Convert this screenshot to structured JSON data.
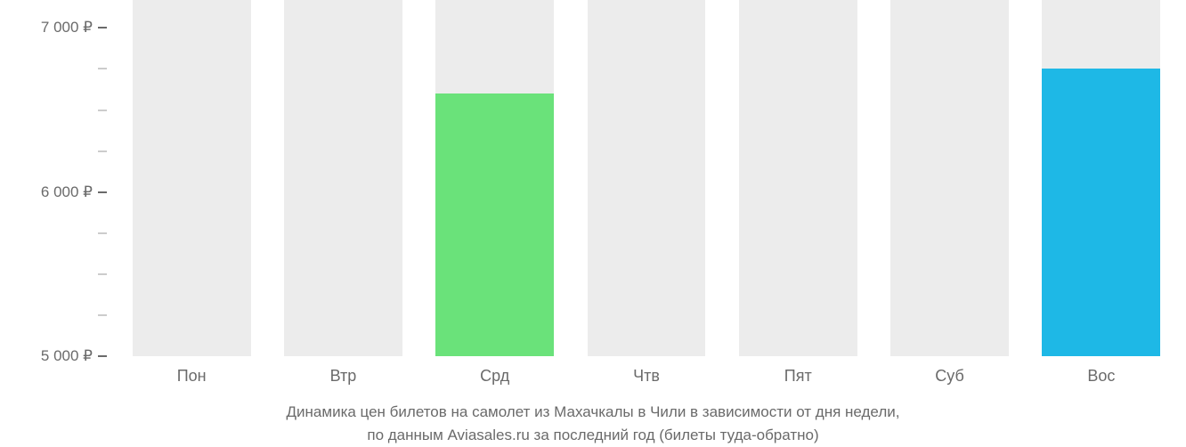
{
  "chart_data": {
    "type": "bar",
    "categories": [
      "Пон",
      "Втр",
      "Срд",
      "Чтв",
      "Пят",
      "Суб",
      "Вос"
    ],
    "values": [
      null,
      null,
      6600,
      null,
      null,
      null,
      6750
    ],
    "max_height_value": 7170,
    "y_ticks": [
      {
        "label": "5 000 ₽",
        "value": 5000
      },
      {
        "label": "6 000 ₽",
        "value": 6000
      },
      {
        "label": "7 000 ₽",
        "value": 7000
      }
    ],
    "y_minor_ticks": [
      5250,
      5500,
      5750,
      6250,
      6500,
      6750
    ],
    "ylim": [
      5000,
      7170
    ],
    "xlabel": "",
    "ylabel": "",
    "colors": {
      "placeholder": "#ececec",
      "lowest": "#6ae27a",
      "highlight": "#1eb8e6"
    },
    "bar_colors": [
      "placeholder",
      "placeholder",
      "lowest",
      "placeholder",
      "placeholder",
      "placeholder",
      "highlight"
    ]
  },
  "caption": {
    "line1": "Динамика цен билетов на самолет из Махачкалы в Чили в зависимости от дня недели,",
    "line2": "по данным Aviasales.ru за последний год (билеты туда-обратно)"
  }
}
